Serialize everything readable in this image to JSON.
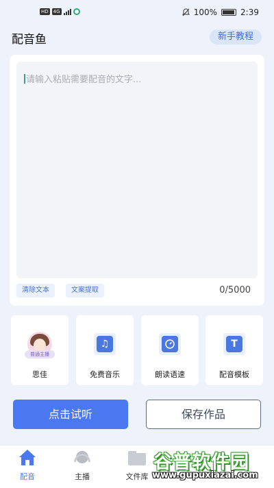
{
  "status_bar": {
    "network_badges": [
      "HD",
      "4G"
    ],
    "battery_percent": "100%",
    "time": "2:39"
  },
  "header": {
    "title": "配音鱼",
    "tutorial_label": "新手教程"
  },
  "editor": {
    "placeholder": "请输入粘贴需要配音的文字...",
    "clear_label": "清除文本",
    "extract_label": "文案提取",
    "counter": "0/5000"
  },
  "tools": [
    {
      "label": "思佳",
      "tag": "普通主播",
      "icon": "avatar"
    },
    {
      "label": "免费音乐",
      "icon": "music-note-icon"
    },
    {
      "label": "朗读语速",
      "icon": "speed-dial-icon"
    },
    {
      "label": "配音模板",
      "icon": "text-template-icon"
    }
  ],
  "actions": {
    "listen_label": "点击试听",
    "save_label": "保存作品"
  },
  "bottom_nav": [
    {
      "label": "配音",
      "active": true,
      "icon": "home-icon"
    },
    {
      "label": "主播",
      "active": false,
      "icon": "headset-icon"
    },
    {
      "label": "文件库",
      "active": false,
      "icon": "folder-icon"
    }
  ],
  "watermark": {
    "name": "谷普软件园",
    "url": "www.gupuxiazai.com"
  },
  "colors": {
    "accent": "#4a78f0",
    "background": "#eef2fb",
    "chip_bg": "#eaf1fd"
  }
}
